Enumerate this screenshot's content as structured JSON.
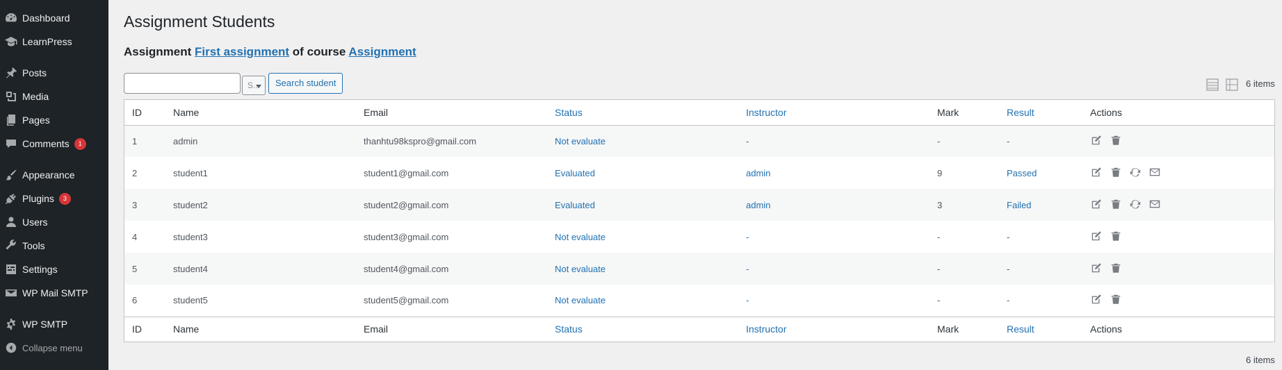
{
  "sidebar": {
    "items": [
      {
        "label": "Dashboard",
        "icon": "dashboard-icon"
      },
      {
        "label": "LearnPress",
        "icon": "learnpress-icon"
      },
      {
        "label": "Posts",
        "icon": "pin-icon"
      },
      {
        "label": "Media",
        "icon": "media-icon"
      },
      {
        "label": "Pages",
        "icon": "pages-icon"
      },
      {
        "label": "Comments",
        "icon": "comment-icon",
        "badge": "1"
      },
      {
        "label": "Appearance",
        "icon": "paintbrush-icon"
      },
      {
        "label": "Plugins",
        "icon": "plugin-icon",
        "badge": "3"
      },
      {
        "label": "Users",
        "icon": "users-icon"
      },
      {
        "label": "Tools",
        "icon": "wrench-icon"
      },
      {
        "label": "Settings",
        "icon": "settings-icon"
      },
      {
        "label": "WP Mail SMTP",
        "icon": "mail-icon"
      },
      {
        "label": "WP SMTP",
        "icon": "gear-icon"
      },
      {
        "label": "Collapse menu",
        "icon": "collapse-arrow-icon"
      }
    ]
  },
  "page": {
    "title": "Assignment Students",
    "subtitle_prefix": "Assignment ",
    "assignment_link": "First assignment",
    "subtitle_middle": " of course ",
    "course_link": "Assignment"
  },
  "search": {
    "value": "",
    "select_value": "S...",
    "button_label": "Search student"
  },
  "pagination": {
    "items_count": "6 items"
  },
  "table": {
    "columns": [
      "ID",
      "Name",
      "Email",
      "Status",
      "Instructor",
      "Mark",
      "Result",
      "Actions"
    ],
    "rows": [
      {
        "id": "1",
        "name": "admin",
        "email": "thanhtu98kspro@gmail.com",
        "status": "Not evaluate",
        "instructor": "-",
        "mark": "-",
        "result": "-",
        "extra_actions": false
      },
      {
        "id": "2",
        "name": "student1",
        "email": "student1@gmail.com",
        "status": "Evaluated",
        "instructor": "admin",
        "mark": "9",
        "result": "Passed",
        "extra_actions": true
      },
      {
        "id": "3",
        "name": "student2",
        "email": "student2@gmail.com",
        "status": "Evaluated",
        "instructor": "admin",
        "mark": "3",
        "result": "Failed",
        "extra_actions": true
      },
      {
        "id": "4",
        "name": "student3",
        "email": "student3@gmail.com",
        "status": "Not evaluate",
        "instructor": "-",
        "mark": "-",
        "result": "-",
        "extra_actions": false
      },
      {
        "id": "5",
        "name": "student4",
        "email": "student4@gmail.com",
        "status": "Not evaluate",
        "instructor": "-",
        "mark": "-",
        "result": "-",
        "extra_actions": false
      },
      {
        "id": "6",
        "name": "student5",
        "email": "student5@gmail.com",
        "status": "Not evaluate",
        "instructor": "-",
        "mark": "-",
        "result": "-",
        "extra_actions": false
      }
    ]
  },
  "colors": {
    "sidebar_bg": "#1d2327",
    "link": "#2271b1",
    "badge": "#d63638",
    "page_bg": "#f0f0f1"
  }
}
